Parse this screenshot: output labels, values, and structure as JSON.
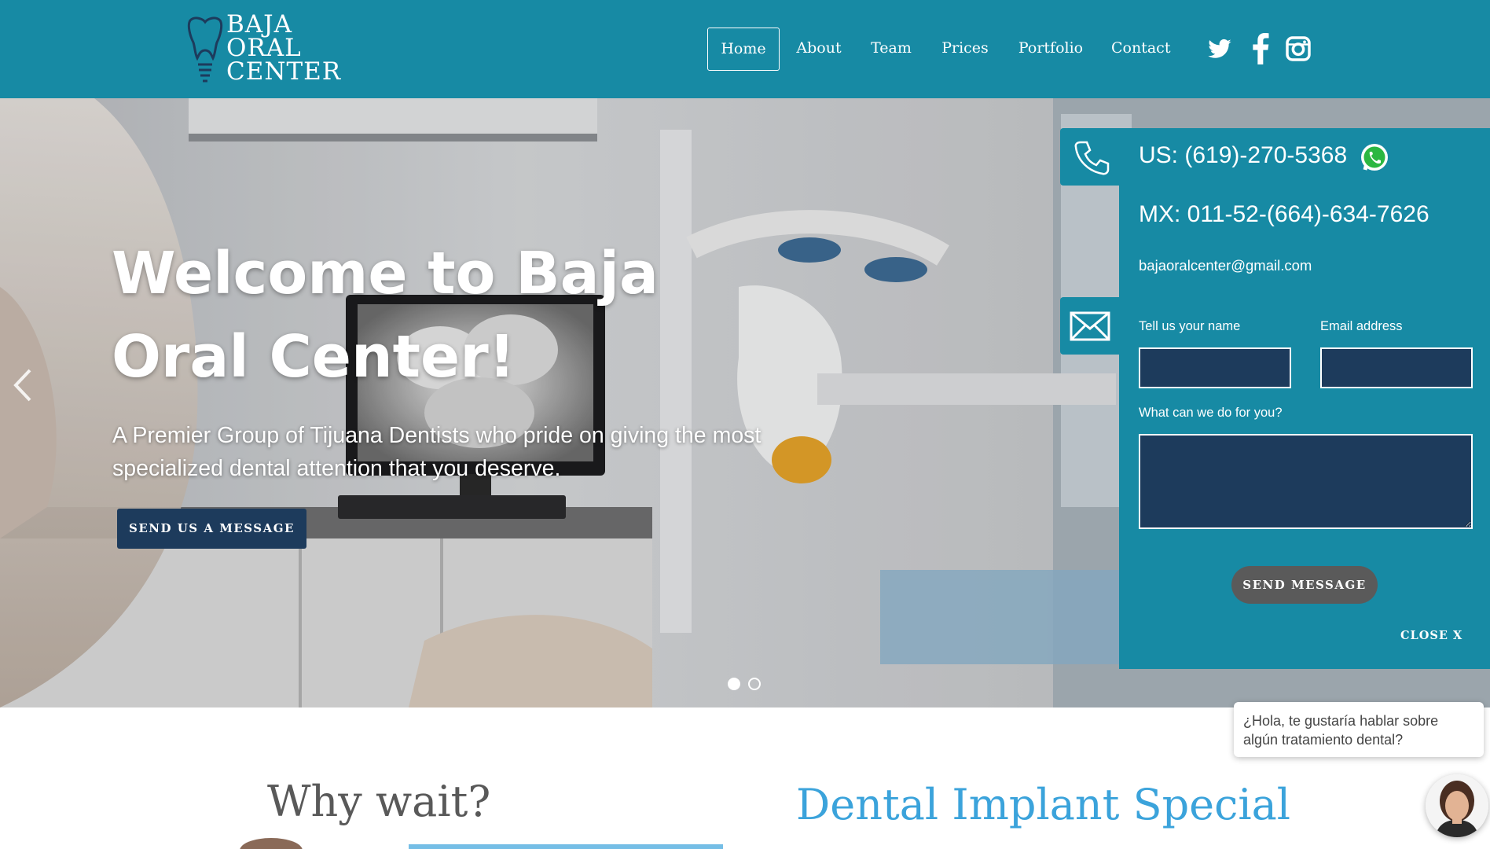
{
  "brand": {
    "logo_lines": [
      "BAJA",
      "ORAL",
      "CENTER"
    ]
  },
  "nav": {
    "items": [
      {
        "label": "Home",
        "active": true
      },
      {
        "label": "About",
        "active": false
      },
      {
        "label": "Team",
        "active": false
      },
      {
        "label": "Prices",
        "active": false
      },
      {
        "label": "Portfolio",
        "active": false
      },
      {
        "label": "Contact",
        "active": false
      }
    ],
    "social_icons": [
      "twitter-icon",
      "facebook-icon",
      "instagram-icon"
    ]
  },
  "hero": {
    "title": "Welcome to Baja Oral Center!",
    "subtitle": "A Premier Group of Tijuana Dentists who pride on giving the most specialized dental attention that you deserve.",
    "cta_label": "SEND US A MESSAGE",
    "slides_total": 2,
    "active_slide": 1
  },
  "contact_panel": {
    "phone_us": "US: (619)-270-5368",
    "phone_mx": "MX: 011-52-(664)-634-7626",
    "email": "bajaoralcenter@gmail.com",
    "name_label": "Tell us your name",
    "name_value": "",
    "email_label": "Email address",
    "email_value": "",
    "message_label": "What can we do for you?",
    "message_value": "",
    "send_label": "SEND MESSAGE",
    "close_label": "CLOSE X"
  },
  "sections": {
    "why_title": "Why wait?",
    "special_title": "Dental Implant Special"
  },
  "chat": {
    "bubble_text": "¿Hola, te gustaría hablar sobre algún tratamiento dental?"
  },
  "colors": {
    "header": "#178aa4",
    "panel": "#178aa4",
    "navy": "#1d3b5c",
    "send_button": "#5a5a5a",
    "special_title": "#3ba3db",
    "why_title": "#595959"
  }
}
